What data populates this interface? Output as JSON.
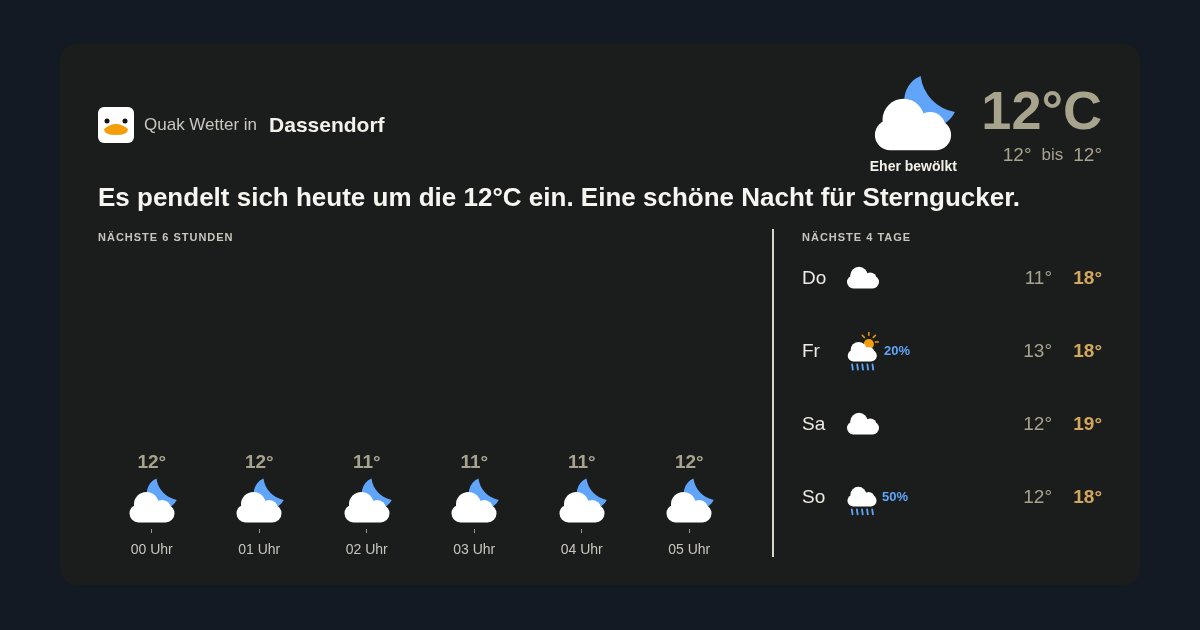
{
  "app": {
    "prefix": "Quak Wetter in",
    "location": "Dassendorf"
  },
  "current": {
    "kind": "cloud-moon",
    "condition": "Eher bewölkt",
    "temperature": "12°C",
    "low": "12°",
    "range_word": "bis",
    "high": "12°"
  },
  "headline": "Es pendelt sich heute um die 12°C ein. Eine schöne Nacht für Sterngucker.",
  "hourly": {
    "title": "NÄCHSTE 6 STUNDEN",
    "hours": [
      {
        "temp": "12°",
        "kind": "cloud-moon",
        "time": "00 Uhr"
      },
      {
        "temp": "12°",
        "kind": "cloud-moon",
        "time": "01 Uhr"
      },
      {
        "temp": "11°",
        "kind": "cloud-moon",
        "time": "02 Uhr"
      },
      {
        "temp": "11°",
        "kind": "cloud-moon",
        "time": "03 Uhr"
      },
      {
        "temp": "11°",
        "kind": "cloud-moon",
        "time": "04 Uhr"
      },
      {
        "temp": "12°",
        "kind": "cloud-moon",
        "time": "05 Uhr"
      }
    ]
  },
  "daily": {
    "title": "NÄCHSTE 4 TAGE",
    "days": [
      {
        "day": "Do",
        "kind": "cloud",
        "low": "11°",
        "high": "18°"
      },
      {
        "day": "Fr",
        "kind": "cloud-sun-rain",
        "precip": "20%",
        "low": "13°",
        "high": "18°"
      },
      {
        "day": "Sa",
        "kind": "cloud",
        "low": "12°",
        "high": "19°"
      },
      {
        "day": "So",
        "kind": "cloud-rain",
        "precip": "50%",
        "low": "12°",
        "high": "18°"
      }
    ]
  }
}
